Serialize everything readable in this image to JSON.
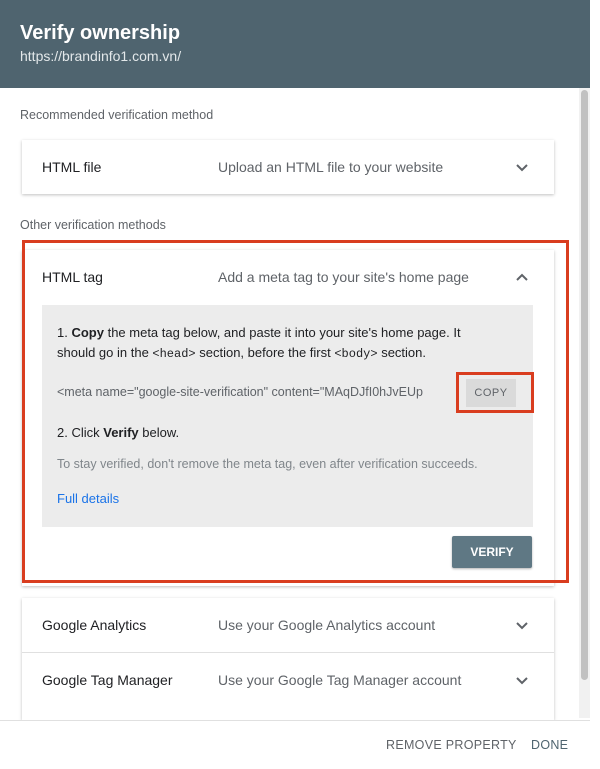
{
  "header": {
    "title": "Verify ownership",
    "url": "https://brandinfo1.com.vn/"
  },
  "recommended": {
    "label": "Recommended verification method",
    "method": {
      "name": "HTML file",
      "desc": "Upload an HTML file to your website",
      "icon": "chevron-down-icon"
    }
  },
  "other": {
    "label": "Other verification methods",
    "html_tag": {
      "name": "HTML tag",
      "desc": "Add a meta tag to your site's home page",
      "icon": "chevron-up-icon",
      "step1_bold": "Copy",
      "step1_a": " the meta tag below, and paste it into your site's home page. It",
      "step1_b": "should go in the ",
      "step1_head": "<head>",
      "step1_c": " section, before the first ",
      "step1_body": "<body>",
      "step1_d": " section.",
      "meta_tag": "<meta name=\"google-site-verification\" content=\"MAqDJfI0hJvEUp",
      "copy_label": "COPY",
      "step2_a": "2. Click ",
      "step2_bold": "Verify",
      "step2_b": " below.",
      "stay_text": "To stay verified, don't remove the meta tag, even after verification succeeds.",
      "full_details": "Full details",
      "verify_label": "VERIFY"
    },
    "methods": [
      {
        "name": "Google Analytics",
        "desc": "Use your Google Analytics account",
        "icon": "chevron-down-icon"
      },
      {
        "name": "Google Tag Manager",
        "desc": "Use your Google Tag Manager account",
        "icon": "chevron-down-icon"
      }
    ]
  },
  "footer": {
    "remove_label": "REMOVE PROPERTY",
    "done_label": "DONE"
  },
  "colors": {
    "header": "#4f646f",
    "highlight": "#d93d1f",
    "link": "#1a73e8",
    "verify": "#5f7884"
  }
}
